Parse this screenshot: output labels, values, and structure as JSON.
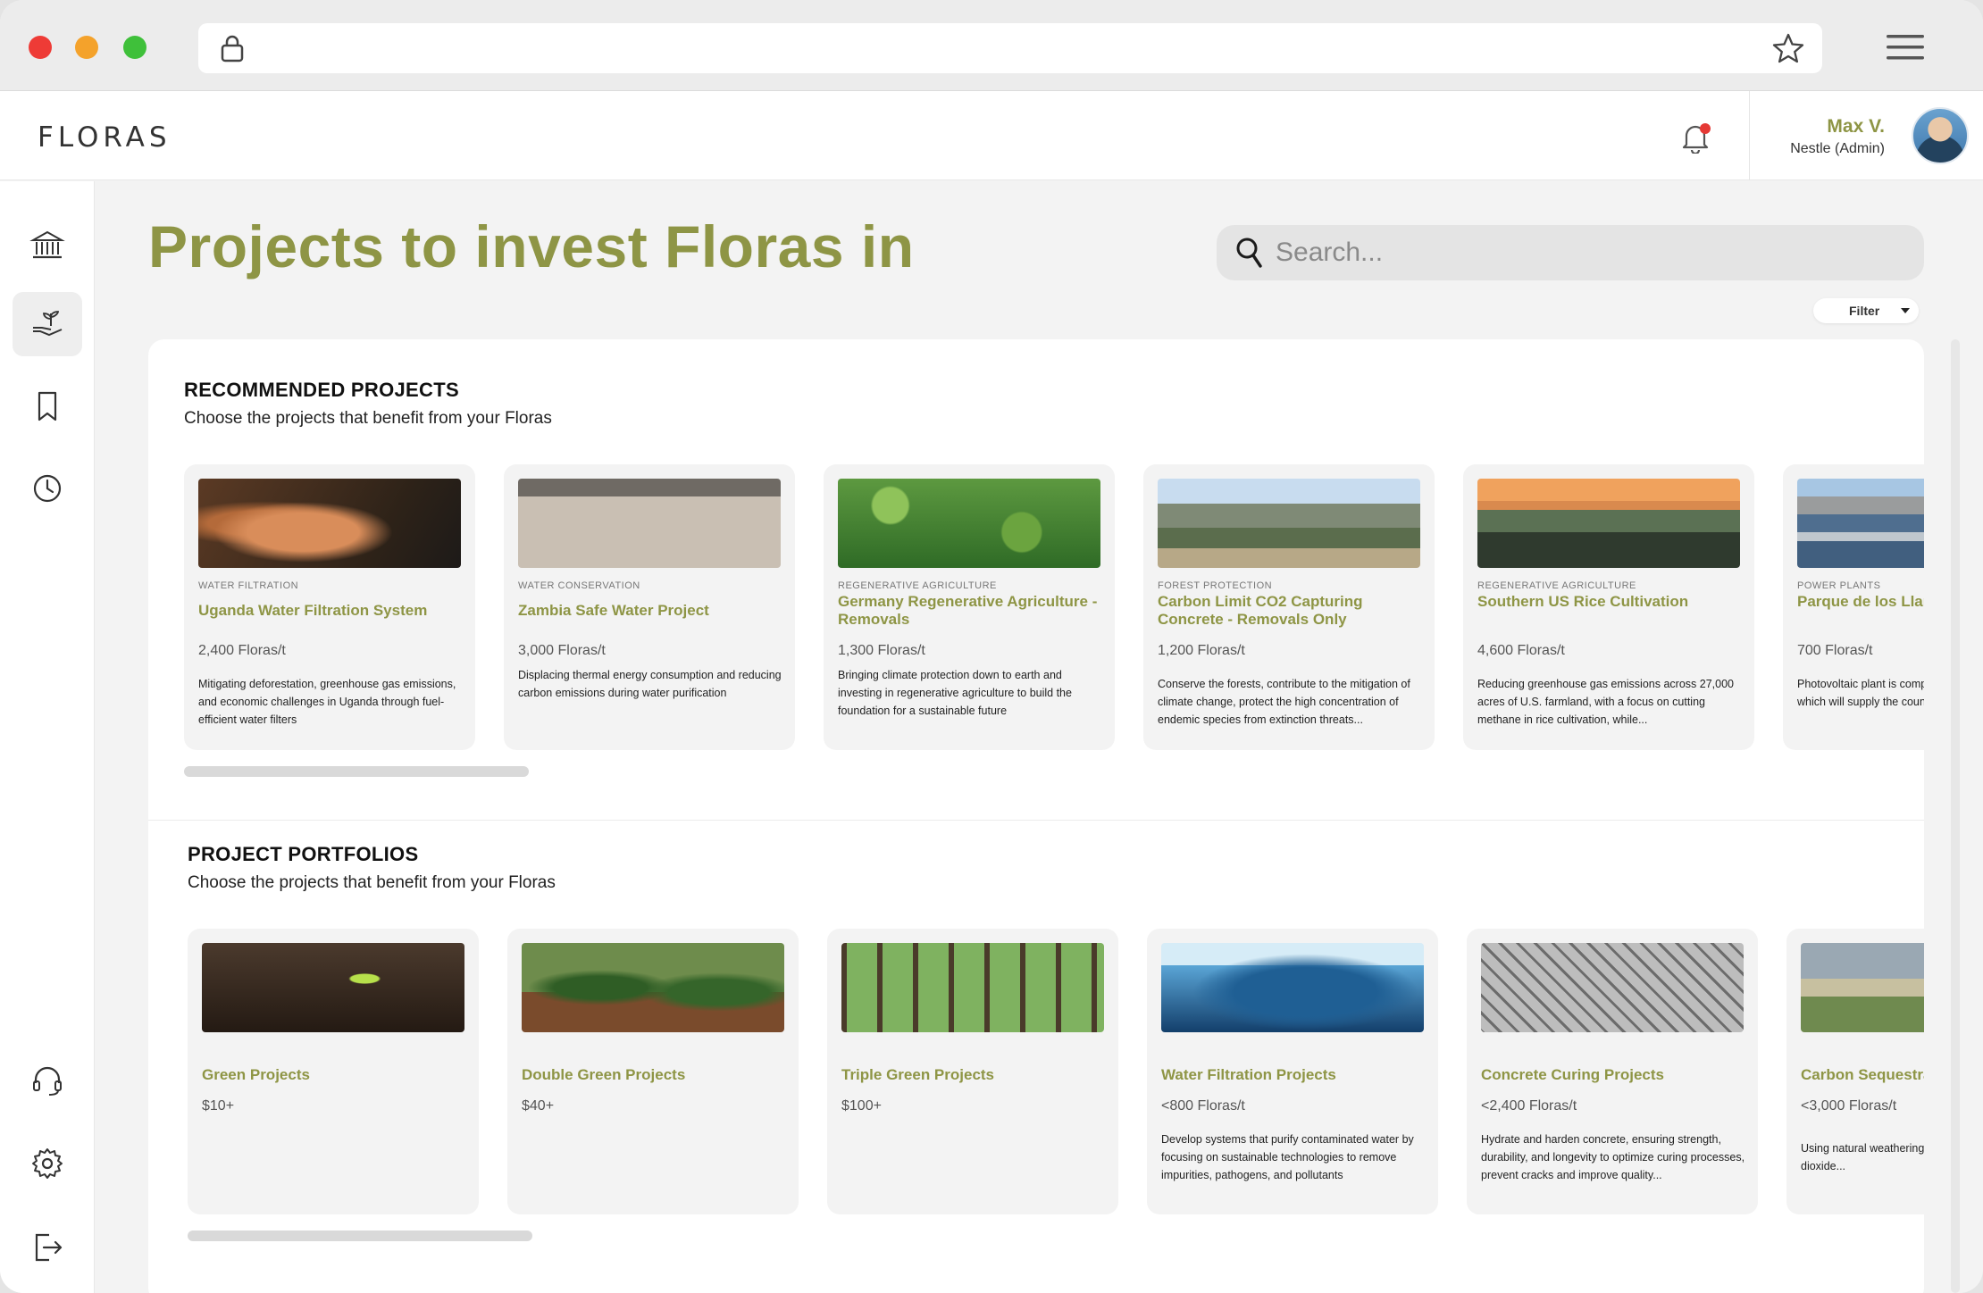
{
  "browser": {
    "window_buttons": [
      "close",
      "minimize",
      "maximize"
    ],
    "icons": [
      "lock-icon",
      "star-icon",
      "hamburger-menu-icon"
    ]
  },
  "header": {
    "logo": "FLORAS",
    "user_name": "Max V.",
    "user_role": "Nestle (Admin)",
    "icons": [
      "bell-icon"
    ],
    "notification_dot_color": "#e53935"
  },
  "sidebar": {
    "items": [
      {
        "name": "bank",
        "icon": "bank-icon",
        "active": false
      },
      {
        "name": "invest",
        "icon": "hand-plant-icon",
        "active": true
      },
      {
        "name": "bookmarks",
        "icon": "bookmark-icon",
        "active": false
      },
      {
        "name": "history",
        "icon": "clock-icon",
        "active": false
      },
      {
        "name": "support",
        "icon": "headset-icon",
        "active": false
      },
      {
        "name": "settings",
        "icon": "gear-icon",
        "active": false
      },
      {
        "name": "logout",
        "icon": "logout-icon",
        "active": false
      }
    ]
  },
  "page": {
    "title": "Projects to invest Floras in",
    "search_placeholder": "Search...",
    "filter_label": "Filter",
    "accent_color": "#8e9545"
  },
  "recommended": {
    "title": "RECOMMENDED PROJECTS",
    "subtitle": "Choose the projects that benefit from your Floras",
    "cards": [
      {
        "category": "WATER FILTRATION",
        "name": "Uganda Water Filtration System",
        "price": "2,400 Floras/t",
        "desc": "Mitigating deforestation, greenhouse gas emissions, and economic challenges in Uganda through fuel-efficient water filters"
      },
      {
        "category": "WATER CONSERVATION",
        "name": "Zambia Safe Water Project",
        "price": "3,000 Floras/t",
        "desc": "Displacing thermal energy consumption and reducing carbon emissions during water purification"
      },
      {
        "category": "REGENERATIVE AGRICULTURE",
        "name": "Germany Regenerative Agriculture - Removals",
        "price": "1,300 Floras/t",
        "desc": "Bringing climate protection down to earth and investing in regenerative agriculture to build the foundation for a sustainable future"
      },
      {
        "category": "FOREST PROTECTION",
        "name": "Carbon Limit CO2 Capturing Concrete - Removals Only",
        "price": "1,200 Floras/t",
        "desc": "Conserve the forests, contribute to the mitigation of climate change, protect the high concentration of endemic species from extinction threats..."
      },
      {
        "category": "REGENERATIVE AGRICULTURE",
        "name": "Southern US Rice Cultivation",
        "price": "4,600 Floras/t",
        "desc": "Reducing greenhouse gas emissions across 27,000 acres of U.S. farmland, with a focus on cutting methane in rice cultivation, while..."
      },
      {
        "category": "POWER PLANTS",
        "name": "Parque de los Llanos Power Plants",
        "price": "700 Floras/t",
        "desc": "Photovoltaic plant is comprised of Llanos I, II and III which will supply the country's electricity..."
      }
    ]
  },
  "portfolios": {
    "title": "PROJECT PORTFOLIOS",
    "subtitle": "Choose the projects that benefit from your Floras",
    "cards": [
      {
        "name": "Green Projects",
        "price": "$10+",
        "desc": ""
      },
      {
        "name": "Double Green Projects",
        "price": "$40+",
        "desc": ""
      },
      {
        "name": "Triple Green Projects",
        "price": "$100+",
        "desc": ""
      },
      {
        "name": "Water Filtration Projects",
        "price": "<800 Floras/t",
        "desc": "Develop systems that purify contaminated water by focusing on sustainable technologies to remove impurities, pathogens, and pollutants"
      },
      {
        "name": "Concrete Curing Projects",
        "price": "<2,400 Floras/t",
        "desc": "Hydrate and harden concrete, ensuring strength, durability, and longevity to optimize curing processes, prevent cracks and improve quality..."
      },
      {
        "name": "Carbon Sequestration",
        "price": "<3,000 Floras/t",
        "desc": "Using natural weathering to sequester carbon dioxide..."
      }
    ]
  }
}
